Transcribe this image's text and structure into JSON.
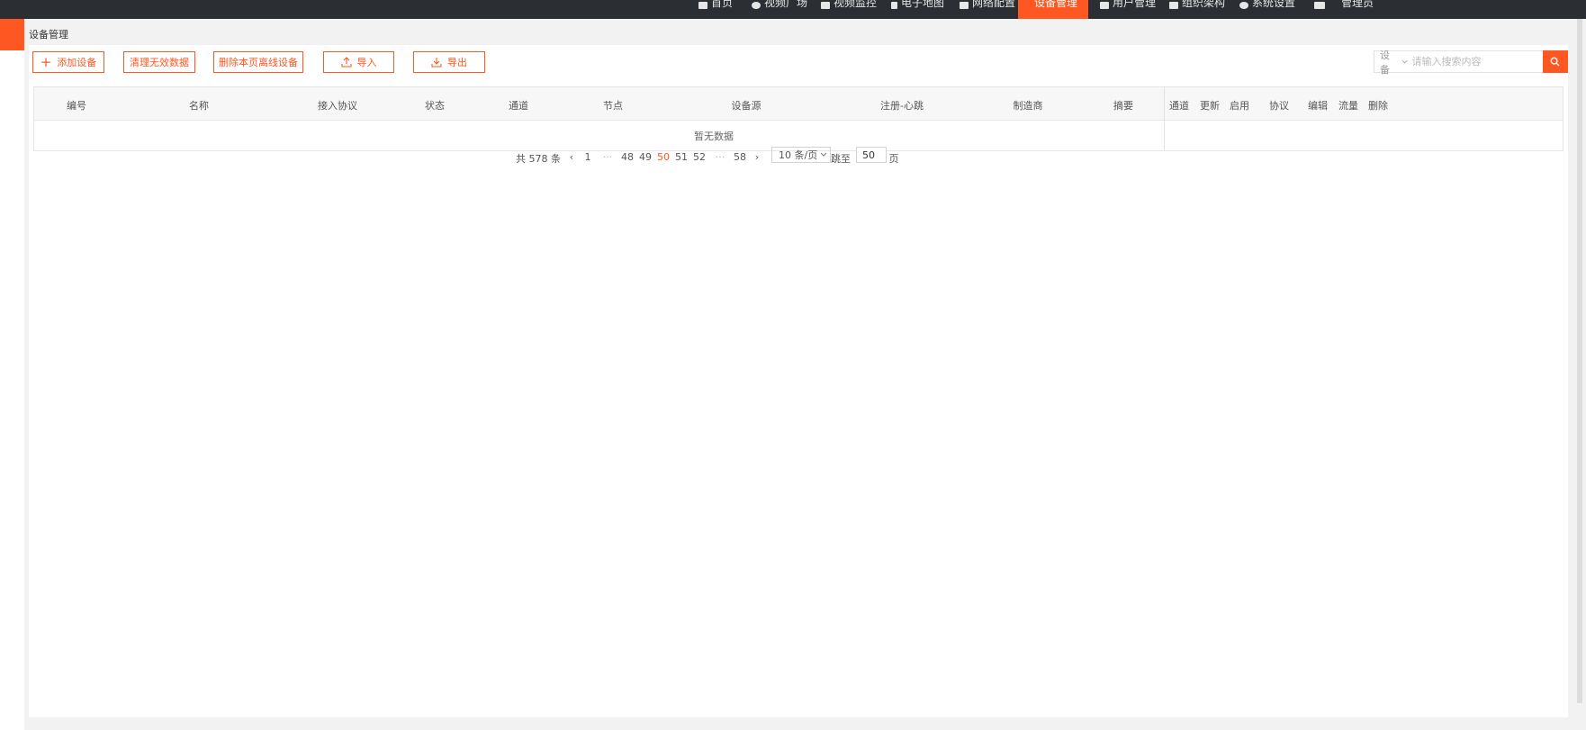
{
  "topnav": {
    "items": [
      {
        "label": "首页",
        "icon": "doc-icon"
      },
      {
        "label": "视频广场",
        "icon": "globe-icon"
      },
      {
        "label": "视频监控",
        "icon": "grid-icon"
      },
      {
        "label": "电子地图",
        "icon": "pin-icon"
      },
      {
        "label": "网络配置",
        "icon": "network-icon"
      },
      {
        "label": "设备管理",
        "icon": "device-icon",
        "active": true
      },
      {
        "label": "用户管理",
        "icon": "user-doc-icon"
      },
      {
        "label": "组织架构",
        "icon": "user-icon"
      },
      {
        "label": "系统设置",
        "icon": "gear-icon"
      },
      {
        "label": "管理员",
        "icon": "bell-icon"
      }
    ],
    "accent": "#ff5722",
    "bg": "#2b2f33"
  },
  "page_tab": "设备管理",
  "toolbar": {
    "add": "添加设备",
    "clean": "清理无效数据",
    "delete_offline": "删除本页离线设备",
    "import": "导入",
    "export": "导出"
  },
  "search": {
    "type": "设备",
    "placeholder": "请输入搜索内容",
    "value": ""
  },
  "table": {
    "columns": [
      "编号",
      "名称",
      "接入协议",
      "状态",
      "通道",
      "节点",
      "设备源",
      "注册-心跳",
      "制造商",
      "摘要"
    ],
    "fixed_columns": [
      "通道",
      "更新",
      "启用",
      "协议",
      "编辑",
      "流量",
      "删除"
    ],
    "empty_text": "暂无数据",
    "rows": []
  },
  "pagination": {
    "total_text": "共 578 条",
    "first": "1",
    "dots": "···",
    "pages": [
      "48",
      "49",
      "50",
      "51",
      "52"
    ],
    "last": "58",
    "current": "50",
    "per_page": "10 条/页",
    "jump_label": "跳至",
    "jump_value": "50",
    "page_unit": "页"
  }
}
